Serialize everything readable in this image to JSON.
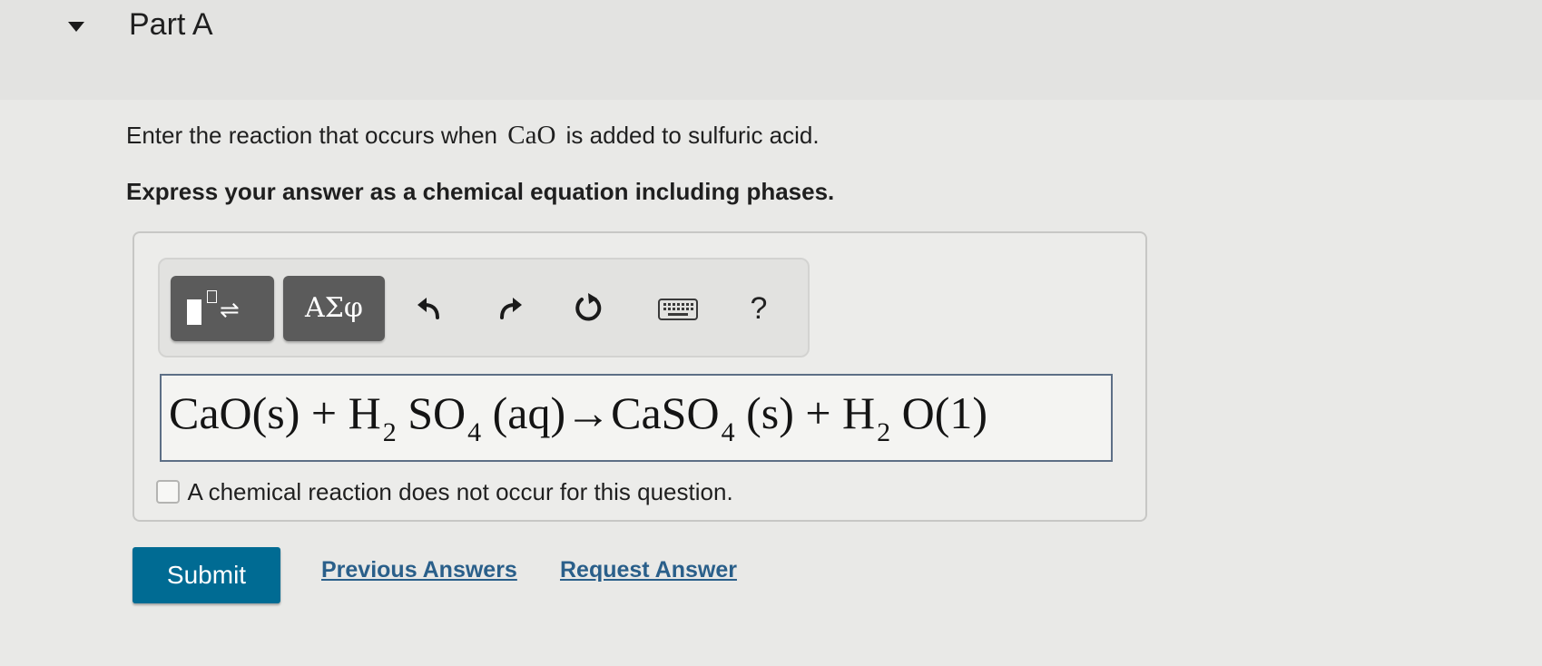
{
  "part": {
    "title": "Part A"
  },
  "question": {
    "prefix": "Enter the reaction that occurs when",
    "compound": "CaO",
    "suffix": "is added to sulfuric acid.",
    "instruction": "Express your answer as a chemical equation including phases."
  },
  "toolbar": {
    "templates_arrows": "⇌",
    "greek_label": "ΑΣφ",
    "help_label": "?",
    "icons": [
      "templates-icon",
      "greek-symbols-icon",
      "undo-icon",
      "redo-icon",
      "reset-icon",
      "keyboard-icon",
      "help-icon"
    ]
  },
  "answer": {
    "t1": "CaO(s) + H",
    "s1": "2",
    "t2": " SO",
    "s2": "4",
    "t3": " (aq)→CaSO",
    "s3": "4",
    "t4": " (s) + H",
    "s4": "2",
    "t5": " O(1)"
  },
  "no_reaction": {
    "label": "A chemical reaction does not occur for this question.",
    "checked": false
  },
  "actions": {
    "submit": "Submit",
    "previous_answers": "Previous Answers",
    "request_answer": "Request Answer"
  },
  "colors": {
    "submit": "#006b93",
    "link": "#2a5f8a",
    "toolbar_button": "#5b5b5b",
    "input_border": "#5d6f86"
  }
}
